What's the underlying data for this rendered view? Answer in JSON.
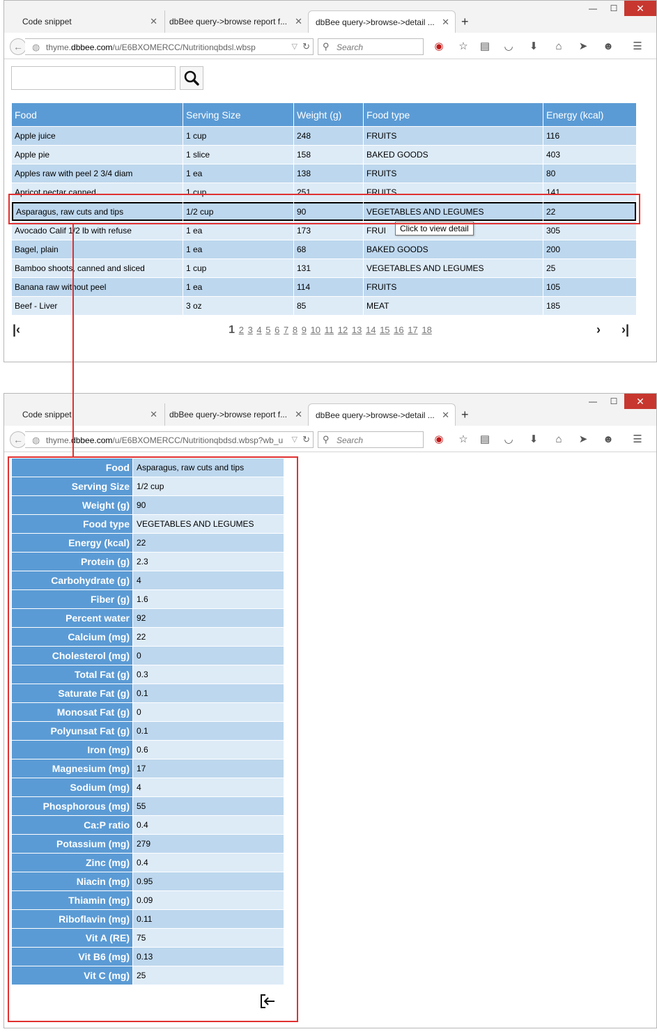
{
  "browser": {
    "tabs": [
      {
        "label": "Code snippet"
      },
      {
        "label": "dbBee query->browse report f..."
      },
      {
        "label": "dbBee query->browse->detail ..."
      }
    ],
    "search_placeholder": "Search",
    "window1": {
      "url_prefix": "thyme.",
      "url_domain": "dbbee.com",
      "url_path": "/u/E6BXOMERCC/Nutritionqbdsl.wbsp"
    },
    "window2": {
      "url_prefix": "thyme.",
      "url_domain": "dbbee.com",
      "url_path": "/u/E6BXOMERCC/Nutritionqbdsd.wbsp?wb_u"
    }
  },
  "list": {
    "filter_value": "",
    "columns": [
      "Food",
      "Serving Size",
      "Weight (g)",
      "Food type",
      "Energy (kcal)"
    ],
    "rows": [
      {
        "food": "Apple juice",
        "serving": "1 cup",
        "weight": "248",
        "type": "FRUITS",
        "energy": "116"
      },
      {
        "food": "Apple pie",
        "serving": "1 slice",
        "weight": "158",
        "type": "BAKED GOODS",
        "energy": "403"
      },
      {
        "food": "Apples raw with peel 2 3/4 diam",
        "serving": "1 ea",
        "weight": "138",
        "type": "FRUITS",
        "energy": "80"
      },
      {
        "food": "Apricot nectar canned",
        "serving": "1 cup",
        "weight": "251",
        "type": "FRUITS",
        "energy": "141"
      },
      {
        "food": "Asparagus, raw cuts and tips",
        "serving": "1/2 cup",
        "weight": "90",
        "type": "VEGETABLES AND LEGUMES",
        "energy": "22"
      },
      {
        "food": "Avocado Calif 1/2 lb with refuse",
        "serving": "1 ea",
        "weight": "173",
        "type": "FRUI",
        "energy": "305"
      },
      {
        "food": "Bagel, plain",
        "serving": "1 ea",
        "weight": "68",
        "type": "BAKED GOODS",
        "energy": "200"
      },
      {
        "food": "Bamboo shoots, canned and sliced",
        "serving": "1 cup",
        "weight": "131",
        "type": "VEGETABLES AND LEGUMES",
        "energy": "25"
      },
      {
        "food": "Banana raw without peel",
        "serving": "1 ea",
        "weight": "114",
        "type": "FRUITS",
        "energy": "105"
      },
      {
        "food": "Beef - Liver",
        "serving": "3 oz",
        "weight": "85",
        "type": "MEAT",
        "energy": "185"
      }
    ],
    "tooltip": "Click to view detail",
    "current_page": "1",
    "pages": [
      "2",
      "3",
      "4",
      "5",
      "6",
      "7",
      "8",
      "9",
      "10",
      "11",
      "12",
      "13",
      "14",
      "15",
      "16",
      "17",
      "18"
    ]
  },
  "detail": {
    "fields": [
      {
        "label": "Food",
        "value": "Asparagus, raw cuts and tips"
      },
      {
        "label": "Serving Size",
        "value": "1/2 cup"
      },
      {
        "label": "Weight (g)",
        "value": "90"
      },
      {
        "label": "Food type",
        "value": "VEGETABLES AND LEGUMES"
      },
      {
        "label": "Energy (kcal)",
        "value": "22"
      },
      {
        "label": "Protein (g)",
        "value": "2.3"
      },
      {
        "label": "Carbohydrate (g)",
        "value": "4"
      },
      {
        "label": "Fiber (g)",
        "value": "1.6"
      },
      {
        "label": "Percent water",
        "value": "92"
      },
      {
        "label": "Calcium (mg)",
        "value": "22"
      },
      {
        "label": "Cholesterol (mg)",
        "value": "0"
      },
      {
        "label": "Total Fat (g)",
        "value": "0.3"
      },
      {
        "label": "Saturate Fat (g)",
        "value": "0.1"
      },
      {
        "label": "Monosat Fat (g)",
        "value": "0"
      },
      {
        "label": "Polyunsat Fat (g)",
        "value": "0.1"
      },
      {
        "label": "Iron (mg)",
        "value": "0.6"
      },
      {
        "label": "Magnesium (mg)",
        "value": "17"
      },
      {
        "label": "Sodium (mg)",
        "value": "4"
      },
      {
        "label": "Phosphorous (mg)",
        "value": "55"
      },
      {
        "label": "Ca:P ratio",
        "value": "0.4"
      },
      {
        "label": "Potassium (mg)",
        "value": "279"
      },
      {
        "label": "Zinc (mg)",
        "value": "0.4"
      },
      {
        "label": "Niacin (mg)",
        "value": "0.95"
      },
      {
        "label": "Thiamin (mg)",
        "value": "0.09"
      },
      {
        "label": "Riboflavin (mg)",
        "value": "0.11"
      },
      {
        "label": "Vit A (RE)",
        "value": "75"
      },
      {
        "label": "Vit B6 (mg)",
        "value": "0.13"
      },
      {
        "label": "Vit C (mg)",
        "value": "25"
      }
    ]
  },
  "icons": {
    "back": "back-arrow-icon",
    "globe": "globe-icon",
    "reload": "reload-icon",
    "search": "search-icon",
    "record": "record-icon",
    "bookmark": "star-icon",
    "reading_list": "reading-list-icon",
    "pocket": "pocket-icon",
    "download": "download-icon",
    "home": "home-icon",
    "send": "send-icon",
    "chat": "chat-icon",
    "menu": "hamburger-menu-icon",
    "first_page": "first-page-icon",
    "next_page": "next-page-icon",
    "last_page": "last-page-icon",
    "return": "return-to-list-icon"
  },
  "colors": {
    "header": "#5b9bd5",
    "row_odd": "#bdd7ee",
    "row_even": "#ddebf7",
    "highlight": "#e03131"
  }
}
